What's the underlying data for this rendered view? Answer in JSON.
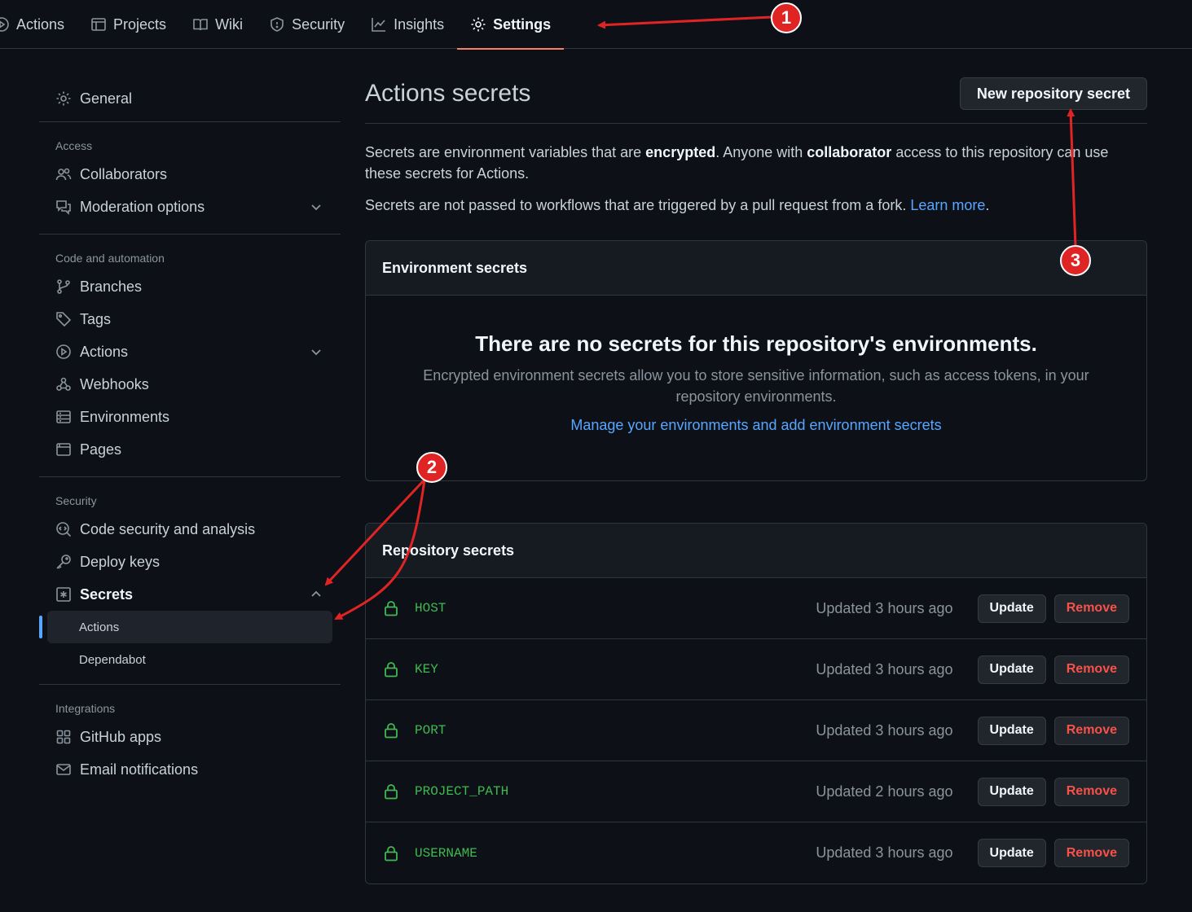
{
  "topnav": {
    "tabs": [
      {
        "label": "Actions",
        "icon": "play-circle-icon"
      },
      {
        "label": "Projects",
        "icon": "table-icon"
      },
      {
        "label": "Wiki",
        "icon": "book-icon"
      },
      {
        "label": "Security",
        "icon": "shield-icon"
      },
      {
        "label": "Insights",
        "icon": "graph-icon"
      },
      {
        "label": "Settings",
        "icon": "gear-icon",
        "active": true
      }
    ]
  },
  "sidebar": {
    "general": "General",
    "access_heading": "Access",
    "collaborators": "Collaborators",
    "moderation": "Moderation options",
    "code_heading": "Code and automation",
    "branches": "Branches",
    "tags": "Tags",
    "actions": "Actions",
    "webhooks": "Webhooks",
    "environments": "Environments",
    "pages": "Pages",
    "security_heading": "Security",
    "code_security": "Code security and analysis",
    "deploy_keys": "Deploy keys",
    "secrets": "Secrets",
    "secrets_actions": "Actions",
    "secrets_dependabot": "Dependabot",
    "integrations_heading": "Integrations",
    "github_apps": "GitHub apps",
    "email_notifications": "Email notifications"
  },
  "main": {
    "title": "Actions secrets",
    "new_secret_button": "New repository secret",
    "intro_1": "Secrets are environment variables that are ",
    "intro_bold_1": "encrypted",
    "intro_2": ". Anyone with ",
    "intro_bold_2": "collaborator",
    "intro_3": " access to this repository can use these secrets for Actions.",
    "fork_note": "Secrets are not passed to workflows that are triggered by a pull request from a fork. ",
    "learn_more": "Learn more",
    "period": ".",
    "env_heading": "Environment secrets",
    "env_empty_title": "There are no secrets for this repository's environments.",
    "env_empty_desc": "Encrypted environment secrets allow you to store sensitive information, such as access tokens, in your repository environments.",
    "env_link": "Manage your environments and add environment secrets",
    "repo_heading": "Repository secrets",
    "update_label": "Update",
    "remove_label": "Remove",
    "secrets": [
      {
        "name": "HOST",
        "updated": "Updated 3 hours ago"
      },
      {
        "name": "KEY",
        "updated": "Updated 3 hours ago"
      },
      {
        "name": "PORT",
        "updated": "Updated 3 hours ago"
      },
      {
        "name": "PROJECT_PATH",
        "updated": "Updated 2 hours ago"
      },
      {
        "name": "USERNAME",
        "updated": "Updated 3 hours ago"
      }
    ]
  },
  "annotations": {
    "badge_1": "1",
    "badge_2": "2",
    "badge_3": "3",
    "color": "#e02424"
  }
}
